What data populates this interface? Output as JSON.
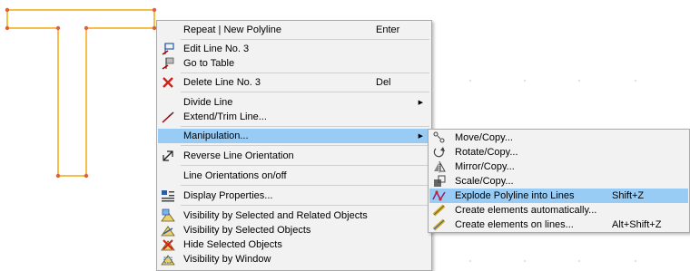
{
  "main_menu": {
    "items": [
      {
        "label": "Repeat | New Polyline",
        "shortcut": "Enter",
        "icon": "none"
      },
      {
        "label": "Edit Line No. 3",
        "shortcut": "",
        "icon": "edit-line-icon"
      },
      {
        "label": "Go to Table",
        "shortcut": "",
        "icon": "table-flag-icon"
      },
      {
        "label": "Delete Line No. 3",
        "shortcut": "Del",
        "icon": "delete-x-icon"
      },
      {
        "label": "Divide Line",
        "shortcut": "",
        "icon": "none",
        "submenu": true
      },
      {
        "label": "Extend/Trim Line...",
        "shortcut": "",
        "icon": "extend-line-icon"
      },
      {
        "label": "Manipulation...",
        "shortcut": "",
        "icon": "none",
        "submenu": true,
        "highlighted": true
      },
      {
        "label": "Reverse Line Orientation",
        "shortcut": "",
        "icon": "reverse-icon"
      },
      {
        "label": "Line Orientations on/off",
        "shortcut": "",
        "icon": "none"
      },
      {
        "label": "Display Properties...",
        "shortcut": "",
        "icon": "display-properties-icon"
      },
      {
        "label": "Visibility by Selected and Related Objects",
        "shortcut": "",
        "icon": "visibility-related-icon"
      },
      {
        "label": "Visibility by Selected Objects",
        "shortcut": "",
        "icon": "visibility-selected-icon"
      },
      {
        "label": "Hide Selected Objects",
        "shortcut": "",
        "icon": "hide-objects-icon"
      },
      {
        "label": "Visibility by Window",
        "shortcut": "",
        "icon": "visibility-window-icon"
      }
    ]
  },
  "sub_menu": {
    "items": [
      {
        "label": "Move/Copy...",
        "shortcut": "",
        "icon": "move-copy-icon"
      },
      {
        "label": "Rotate/Copy...",
        "shortcut": "",
        "icon": "rotate-copy-icon"
      },
      {
        "label": "Mirror/Copy...",
        "shortcut": "",
        "icon": "mirror-copy-icon"
      },
      {
        "label": "Scale/Copy...",
        "shortcut": "",
        "icon": "scale-copy-icon"
      },
      {
        "label": "Explode Polyline into Lines",
        "shortcut": "Shift+Z",
        "icon": "explode-polyline-icon",
        "highlighted": true
      },
      {
        "label": "Create elements automatically...",
        "shortcut": "",
        "icon": "create-elements-auto-icon"
      },
      {
        "label": "Create elements on lines...",
        "shortcut": "Alt+Shift+Z",
        "icon": "create-elements-lines-icon"
      }
    ]
  },
  "colors": {
    "polyline": "#f5c04a",
    "node": "#e0603a",
    "highlight": "#99ccf5",
    "menu_bg": "#f2f2f2"
  }
}
